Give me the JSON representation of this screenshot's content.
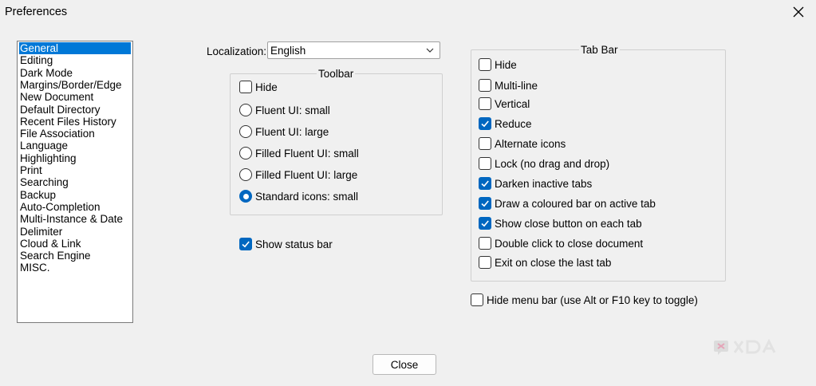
{
  "window": {
    "title": "Preferences",
    "close_icon": "close-icon"
  },
  "sidebar": {
    "items": [
      {
        "label": "General",
        "selected": true
      },
      {
        "label": "Editing"
      },
      {
        "label": "Dark Mode"
      },
      {
        "label": "Margins/Border/Edge"
      },
      {
        "label": "New Document"
      },
      {
        "label": "Default Directory"
      },
      {
        "label": "Recent Files History"
      },
      {
        "label": "File Association"
      },
      {
        "label": "Language"
      },
      {
        "label": "Highlighting"
      },
      {
        "label": "Print"
      },
      {
        "label": "Searching"
      },
      {
        "label": "Backup"
      },
      {
        "label": "Auto-Completion"
      },
      {
        "label": "Multi-Instance & Date"
      },
      {
        "label": "Delimiter"
      },
      {
        "label": "Cloud & Link"
      },
      {
        "label": "Search Engine"
      },
      {
        "label": "MISC."
      }
    ]
  },
  "localization": {
    "label": "Localization:",
    "value": "English"
  },
  "toolbar": {
    "title": "Toolbar",
    "hide": {
      "label": "Hide",
      "checked": false
    },
    "options": [
      {
        "label": "Fluent UI: small",
        "checked": false
      },
      {
        "label": "Fluent UI: large",
        "checked": false
      },
      {
        "label": "Filled Fluent UI: small",
        "checked": false
      },
      {
        "label": "Filled Fluent UI: large",
        "checked": false
      },
      {
        "label": "Standard icons: small",
        "checked": true
      }
    ]
  },
  "status_bar": {
    "label": "Show status bar",
    "checked": true
  },
  "tab_bar": {
    "title": "Tab Bar",
    "options": [
      {
        "label": "Hide",
        "checked": false
      },
      {
        "label": "Multi-line",
        "checked": false
      },
      {
        "label": "Vertical",
        "checked": false
      },
      {
        "label": "Reduce",
        "checked": true
      },
      {
        "label": "Alternate icons",
        "checked": false
      },
      {
        "label": "Lock (no drag and drop)",
        "checked": false
      },
      {
        "label": "Darken inactive tabs",
        "checked": true
      },
      {
        "label": "Draw a coloured bar on active tab",
        "checked": true
      },
      {
        "label": "Show close button on each tab",
        "checked": true
      },
      {
        "label": "Double click to close document",
        "checked": false
      },
      {
        "label": "Exit on close the last tab",
        "checked": false
      }
    ]
  },
  "menu_bar": {
    "label": "Hide menu bar (use Alt or F10 key to toggle)",
    "checked": false
  },
  "buttons": {
    "close": "Close"
  },
  "watermark": {
    "text": "XDA"
  },
  "colors": {
    "accent": "#0067c0",
    "selection": "#0078d7"
  }
}
